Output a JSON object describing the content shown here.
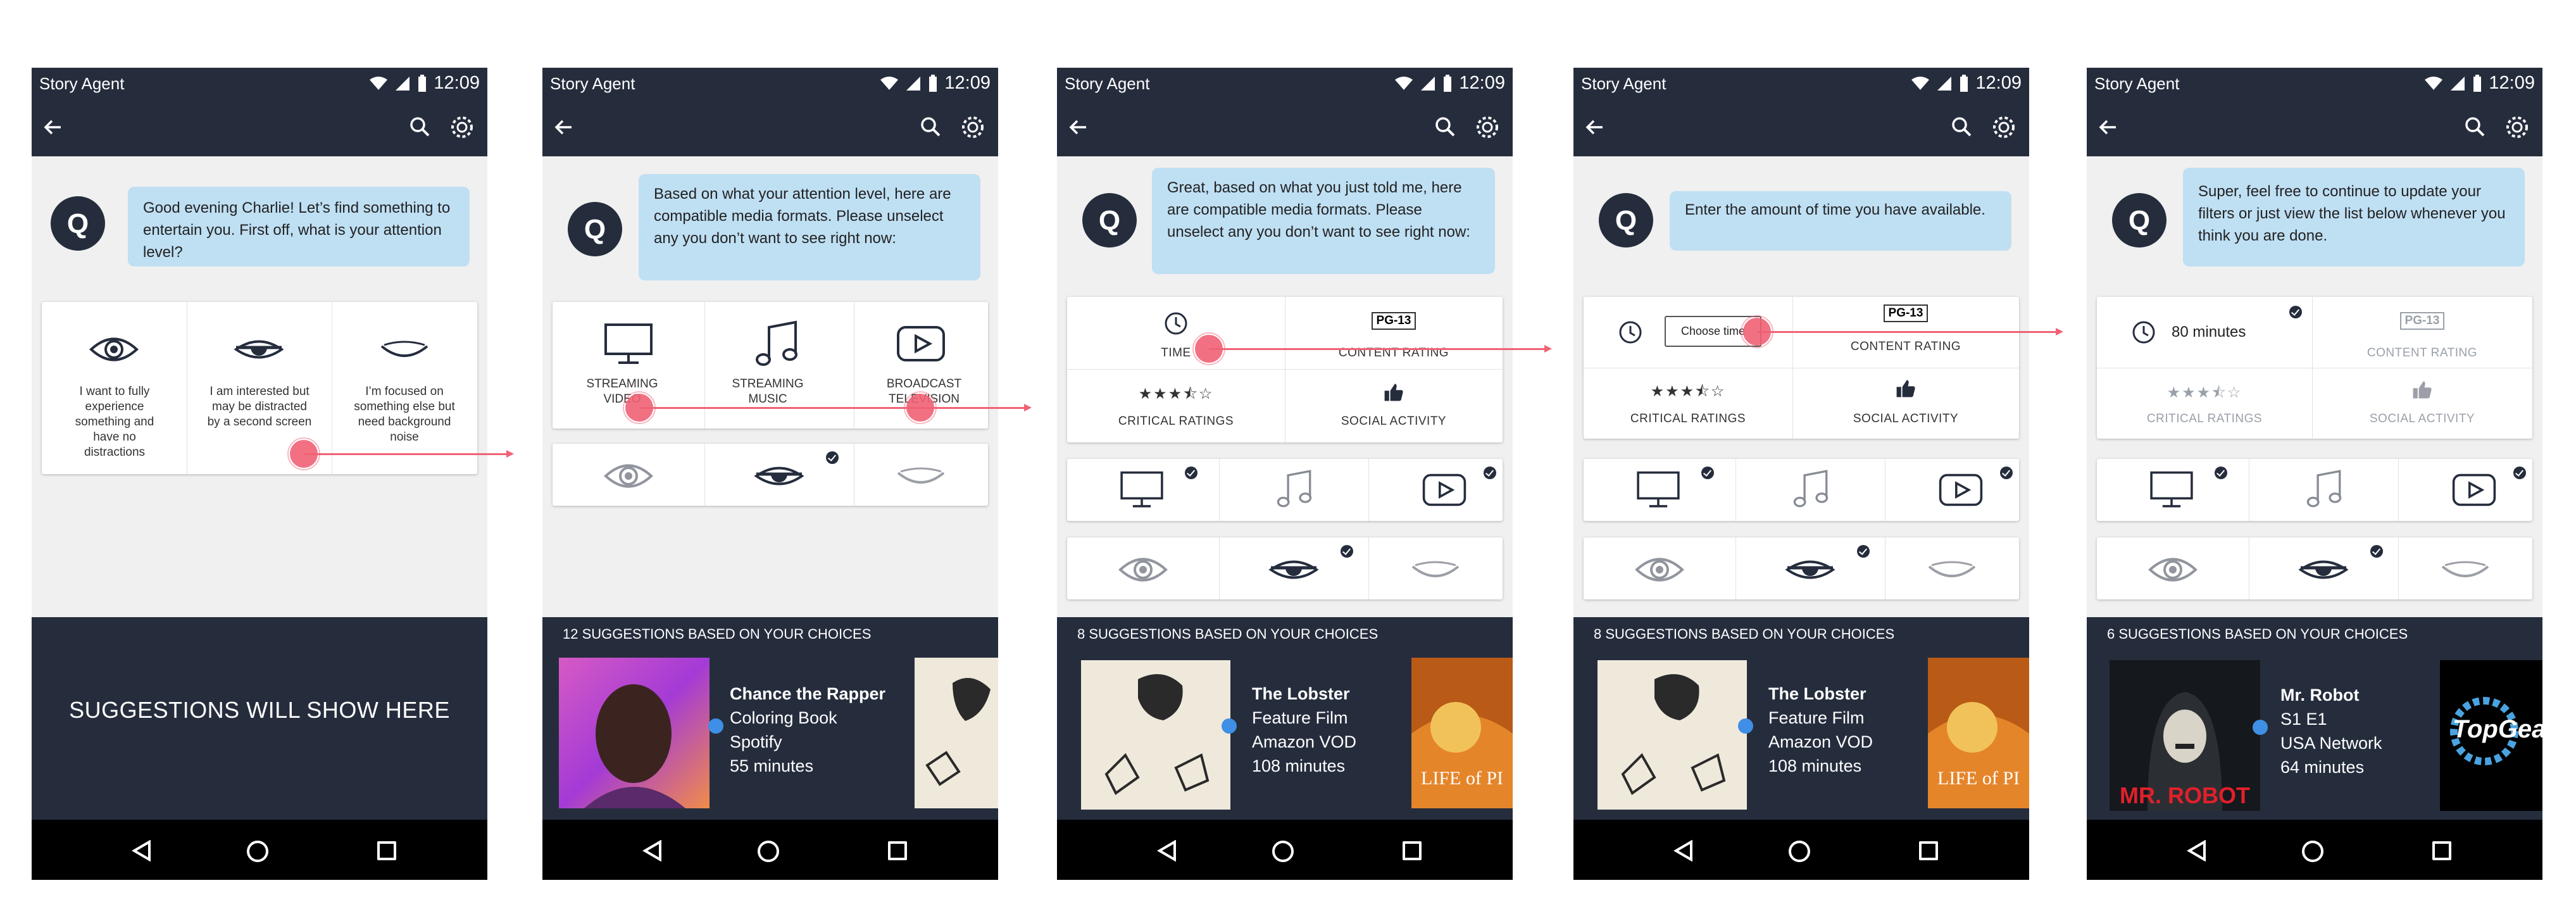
{
  "app_title": "Story Agent",
  "clock": "12:09",
  "avatar_letter": "Q",
  "screens": [
    {
      "bubble": "Good evening Charlie!  Let’s find something to entertain you.  First off, what is your attention level?",
      "attention_options": [
        "I want to fully experience something and have no distractions",
        "I am interested but may be distracted by a second screen",
        "I’m focused on something else but need background noise"
      ],
      "suggestions_placeholder": "SUGGESTIONS WILL SHOW HERE"
    },
    {
      "bubble": "Based on what your attention level, here are compatible media formats.  Please unselect any you don’t want to see right now:",
      "formats": [
        "STREAMING VIDEO",
        "STREAMING MUSIC",
        "BROADCAST TELEVISION"
      ],
      "suggestions_header": "12 SUGGESTIONS BASED ON YOUR CHOICES",
      "suggestion": {
        "title": "Chance the Rapper",
        "line1": "Coloring Book",
        "line2": "Spotify",
        "line3": "55 minutes"
      }
    },
    {
      "bubble": "Great, based on what you just told me, here are compatible media formats.  Please unselect any you don’t want to see right now:",
      "filters": {
        "time": "TIME",
        "rating_badge": "PG-13",
        "content_rating": "CONTENT RATING",
        "critical": "CRITICAL RATINGS",
        "social": "SOCIAL ACTIVITY"
      },
      "suggestions_header": "8 SUGGESTIONS BASED ON YOUR CHOICES",
      "suggestion": {
        "title": "The Lobster",
        "line1": "Feature Film",
        "line2": "Amazon VOD",
        "line3": "108 minutes"
      },
      "next_thumb_text": "LIFE of PI"
    },
    {
      "bubble": "Enter the amount of time you have available.",
      "choose_time": "Choose time",
      "filters": {
        "rating_badge": "PG-13",
        "content_rating": "CONTENT RATING",
        "critical": "CRITICAL RATINGS",
        "social": "SOCIAL ACTIVITY"
      },
      "suggestions_header": "8 SUGGESTIONS BASED ON YOUR CHOICES",
      "suggestion": {
        "title": "The Lobster",
        "line1": "Feature Film",
        "line2": "Amazon VOD",
        "line3": "108 minutes"
      },
      "next_thumb_text": "LIFE of PI"
    },
    {
      "bubble": "Super, feel free to continue to update your filters or just view the list below whenever you think you are done.",
      "time_value": "80 minutes",
      "filters": {
        "rating_badge": "PG-13",
        "content_rating": "CONTENT RATING",
        "critical": "CRITICAL RATINGS",
        "social": "SOCIAL ACTIVITY"
      },
      "suggestions_header": "6 SUGGESTIONS BASED ON YOUR CHOICES",
      "suggestion": {
        "title": "Mr. Robot",
        "line1": "S1 E1",
        "line2": "USA Network",
        "line3": "64 minutes"
      },
      "thumb_text": "MR. ROBOT",
      "next_thumb_text": "TopGear"
    }
  ],
  "colors": {
    "dark": "#252d3d",
    "bubble": "#bfdff3",
    "accent": "#f06275",
    "dot": "#3e8fe5"
  }
}
